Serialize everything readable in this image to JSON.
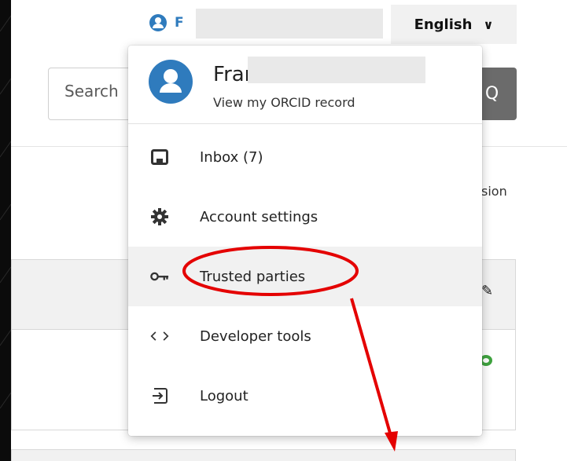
{
  "header": {
    "user_initial": "F",
    "language_label": "English",
    "language_chevron": "∨"
  },
  "search": {
    "placeholder": "Search",
    "button_glyph": "Q"
  },
  "background": {
    "truncated_text": "sion"
  },
  "dropdown": {
    "profile": {
      "name": "Francesca Soldati",
      "link_label": "View my ORCID record"
    },
    "items": [
      {
        "label": "Inbox (7)",
        "icon": "inbox-icon"
      },
      {
        "label": "Account settings",
        "icon": "gear-icon"
      },
      {
        "label": "Trusted parties",
        "icon": "key-icon"
      },
      {
        "label": "Developer tools",
        "icon": "code-icon"
      },
      {
        "label": "Logout",
        "icon": "logout-icon"
      }
    ]
  },
  "colors": {
    "brand_blue": "#2f7bbd",
    "annotation_red": "#e40000",
    "highlight_bg": "#f1f1f1"
  }
}
